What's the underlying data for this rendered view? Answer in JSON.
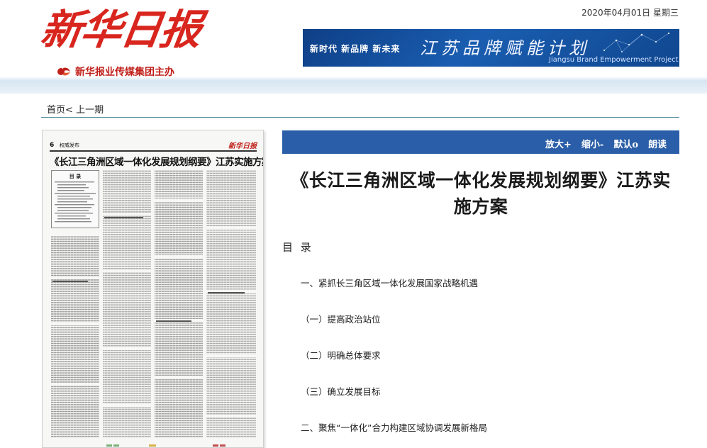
{
  "header": {
    "masthead": "新华日报",
    "sub_brand": "新华报业传媒集团主办",
    "date": "2020年04月01日",
    "weekday": "星期三",
    "banner": {
      "left_text": "新时代  新品牌  新未来",
      "right_text": "江苏品牌赋能计划",
      "sub_text": "Jiangsu Brand Empowerment Project"
    }
  },
  "breadcrumb": {
    "home": "首页",
    "separator": "<",
    "previous": "上一期"
  },
  "thumbnail": {
    "page_number": "6",
    "section": "权威发布",
    "logo": "新华日报",
    "title": "《长江三角洲区域一体化发展规划纲要》江苏实施方案",
    "toc_title": "目  录"
  },
  "toolbar": {
    "zoom_in": "放大+",
    "zoom_out": "缩小-",
    "default": "默认o",
    "read": "朗读"
  },
  "article": {
    "title": "《长江三角洲区域一体化发展规划纲要》江苏实施方案",
    "toc_heading": "目 录",
    "toc_items": [
      "一、紧抓长三角区域一体化发展国家战略机遇",
      "（一）提高政治站位",
      "（二）明确总体要求",
      "（三）确立发展目标",
      "二、聚焦“一体化”合力构建区域协调发展新格局"
    ]
  },
  "colors": {
    "masthead_red": "#d8261e",
    "toolbar_blue": "#2b5ea8",
    "rule_teal": "#4a8a9a"
  }
}
